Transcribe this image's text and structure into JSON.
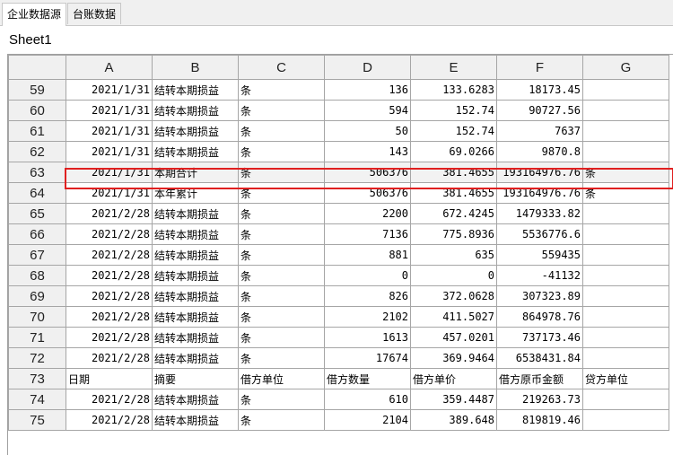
{
  "tabs": [
    {
      "label": "企业数据源",
      "active": true
    },
    {
      "label": "台账数据",
      "active": false
    }
  ],
  "sheet_name": "Sheet1",
  "columns": [
    "A",
    "B",
    "C",
    "D",
    "E",
    "F",
    "G"
  ],
  "rows": [
    {
      "num": "59",
      "cells": [
        "2021/1/31",
        "结转本期损益",
        "条",
        "136",
        "133.6283",
        "18173.45",
        ""
      ]
    },
    {
      "num": "60",
      "cells": [
        "2021/1/31",
        "结转本期损益",
        "条",
        "594",
        "152.74",
        "90727.56",
        ""
      ]
    },
    {
      "num": "61",
      "cells": [
        "2021/1/31",
        "结转本期损益",
        "条",
        "50",
        "152.74",
        "7637",
        ""
      ]
    },
    {
      "num": "62",
      "cells": [
        "2021/1/31",
        "结转本期损益",
        "条",
        "143",
        "69.0266",
        "9870.8",
        ""
      ]
    },
    {
      "num": "63",
      "cells": [
        "2021/1/31",
        "本期合计",
        "条",
        "506376",
        "381.4655",
        "193164976.76",
        "条"
      ],
      "selected": true
    },
    {
      "num": "64",
      "cells": [
        "2021/1/31",
        "本年累计",
        "条",
        "506376",
        "381.4655",
        "193164976.76",
        "条"
      ]
    },
    {
      "num": "65",
      "cells": [
        "2021/2/28",
        "结转本期损益",
        "条",
        "2200",
        "672.4245",
        "1479333.82",
        ""
      ]
    },
    {
      "num": "66",
      "cells": [
        "2021/2/28",
        "结转本期损益",
        "条",
        "7136",
        "775.8936",
        "5536776.6",
        ""
      ]
    },
    {
      "num": "67",
      "cells": [
        "2021/2/28",
        "结转本期损益",
        "条",
        "881",
        "635",
        "559435",
        ""
      ]
    },
    {
      "num": "68",
      "cells": [
        "2021/2/28",
        "结转本期损益",
        "条",
        "0",
        "0",
        "-41132",
        ""
      ]
    },
    {
      "num": "69",
      "cells": [
        "2021/2/28",
        "结转本期损益",
        "条",
        "826",
        "372.0628",
        "307323.89",
        ""
      ]
    },
    {
      "num": "70",
      "cells": [
        "2021/2/28",
        "结转本期损益",
        "条",
        "2102",
        "411.5027",
        "864978.76",
        ""
      ]
    },
    {
      "num": "71",
      "cells": [
        "2021/2/28",
        "结转本期损益",
        "条",
        "1613",
        "457.0201",
        "737173.46",
        ""
      ]
    },
    {
      "num": "72",
      "cells": [
        "2021/2/28",
        "结转本期损益",
        "条",
        "17674",
        "369.9464",
        "6538431.84",
        ""
      ]
    },
    {
      "num": "73",
      "cells": [
        "日期",
        "摘要",
        "借方单位",
        "借方数量",
        "借方单价",
        "借方原币金额",
        "贷方单位"
      ],
      "header_like": true
    },
    {
      "num": "74",
      "cells": [
        "2021/2/28",
        "结转本期损益",
        "条",
        "610",
        "359.4487",
        "219263.73",
        ""
      ]
    },
    {
      "num": "75",
      "cells": [
        "2021/2/28",
        "结转本期损益",
        "条",
        "2104",
        "389.648",
        "819819.46",
        ""
      ]
    }
  ],
  "colors": {
    "selection_border": "#e02020",
    "header_bg": "#f0f0f0",
    "gridline": "#a6a6a6"
  }
}
